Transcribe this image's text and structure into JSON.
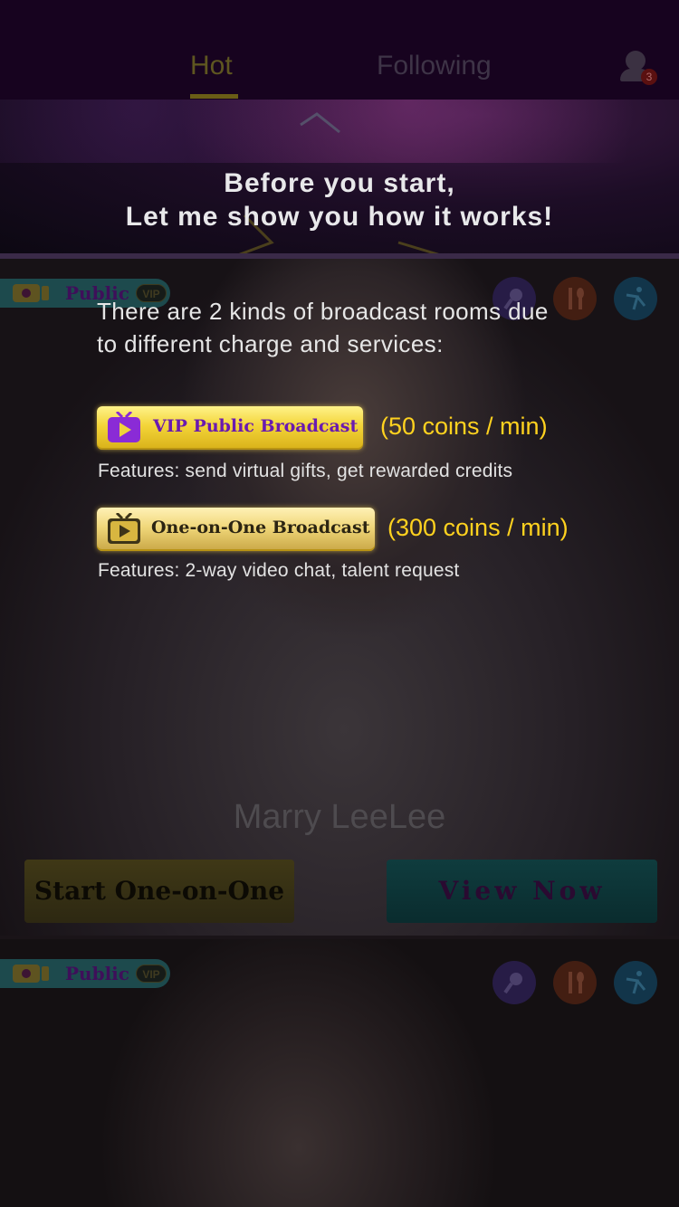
{
  "nav": {
    "tabs": [
      {
        "label": "Hot",
        "active": true
      },
      {
        "label": "Following",
        "active": false
      }
    ],
    "user_icon": "user-icon",
    "notification_count": "3"
  },
  "banner": {
    "line1": "Before you start,",
    "line2": "Let me show you how it works!"
  },
  "tutorial": {
    "intro_line1": "There are 2 kinds of broadcast rooms due",
    "intro_line2": "to different charge and services:",
    "vip": {
      "label": "VIP Public Broadcast",
      "price": "(50 coins / min)",
      "features": "Features: send virtual gifts, get rewarded credits"
    },
    "one_on_one": {
      "label": "One-on-One Broadcast",
      "price": "(300 coins / min)",
      "features": "Features: 2-way video chat, talent request"
    }
  },
  "cards": [
    {
      "type_label": "Public",
      "vip_badge": "VIP",
      "talents": [
        "mic-icon",
        "fork-spoon-icon",
        "dance-icon"
      ],
      "streamer_name": "Marry LeeLee",
      "start_button": "Start One-on-One",
      "view_button": "View Now"
    },
    {
      "type_label": "Public",
      "vip_badge": "VIP",
      "talents": [
        "mic-icon",
        "fork-spoon-icon",
        "dance-icon"
      ]
    }
  ],
  "colors": {
    "accent_gold": "#ffd21f",
    "header_bg": "#17031f",
    "vip_text": "#6a1ab0"
  }
}
